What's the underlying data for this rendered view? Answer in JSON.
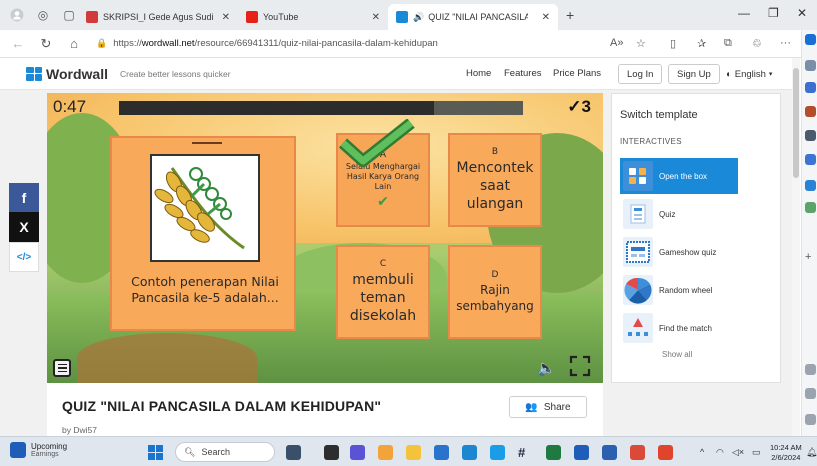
{
  "browser": {
    "tabs": [
      {
        "label": "SKRIPSI_I Gede Agus Sudiantora",
        "favicon_color": "#d23b3b",
        "active": false
      },
      {
        "label": "YouTube",
        "favicon_color": "#e62117",
        "active": false
      },
      {
        "label": "QUIZ \"NILAI PANCASILA DA",
        "favicon_color": "#1a8ad8",
        "active": true
      }
    ],
    "url_prefix": "https://",
    "url_host": "wordwall.net",
    "url_path": "/resource/66941311/quiz-nilai-pancasila-dalam-kehidupan"
  },
  "header": {
    "logo": "Wordwall",
    "tagline": "Create better lessons quicker",
    "links": [
      "Home",
      "Features",
      "Price Plans"
    ],
    "login": "Log In",
    "signup": "Sign Up",
    "language": "English"
  },
  "social": {
    "facebook": "f",
    "x": "X",
    "embed": "</>"
  },
  "game": {
    "timer": "0:47",
    "score": "3",
    "score_icon": "check-icon",
    "time_progress_fraction": 0.78,
    "question": "Contoh penerapan Nilai Pancasila ke-5 adalah...",
    "question_image": "rice-plant",
    "answers": [
      {
        "letter": "A",
        "text": "Selalu Menghargai Hasil Karya Orang Lain",
        "correct": true
      },
      {
        "letter": "B",
        "text": "Mencontek saat ulangan",
        "correct": false
      },
      {
        "letter": "C",
        "text": "membuli teman disekolah",
        "correct": false
      },
      {
        "letter": "D",
        "text": "Rajin sembahyang",
        "correct": false
      }
    ]
  },
  "template_panel": {
    "title": "Switch template",
    "section": "INTERACTIVES",
    "items": [
      {
        "label": "Open the box",
        "active": true
      },
      {
        "label": "Quiz",
        "active": false
      },
      {
        "label": "Gameshow quiz",
        "active": false
      },
      {
        "label": "Random wheel",
        "active": false
      },
      {
        "label": "Find the match",
        "active": false
      }
    ],
    "show_all": "Show all"
  },
  "activity": {
    "title": "QUIZ \"NILAI PANCASILA DALAM KEHIDUPAN\"",
    "share": "Share",
    "author": "by  Dwi57"
  },
  "taskbar": {
    "weather_title": "Upcoming",
    "weather_sub": "Earnings",
    "search": "Search",
    "time": "10:24 AM",
    "date": "2/6/2024"
  },
  "colors": {
    "accent": "#1a8ad8",
    "box": "#f9a95a",
    "correct_check": "#4caf50"
  }
}
